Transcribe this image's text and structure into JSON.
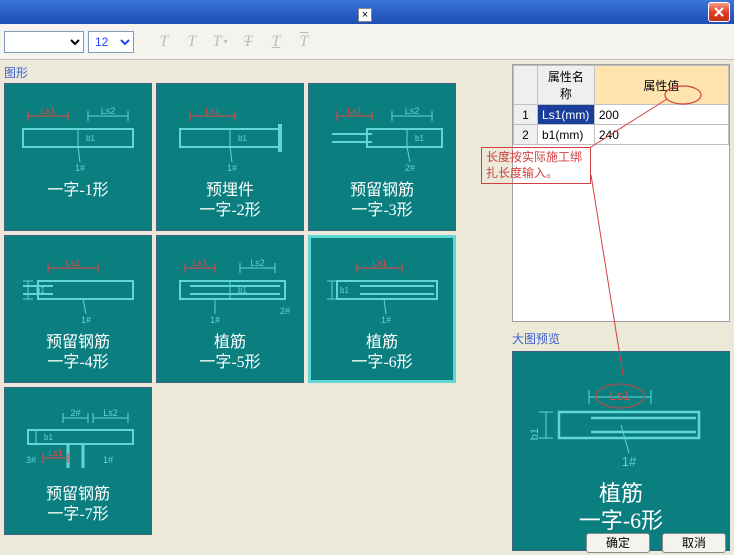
{
  "toolbar": {
    "font_value": "",
    "size_value": "12",
    "btns": [
      "T",
      "T",
      "T",
      "T",
      "T",
      "T"
    ]
  },
  "left": {
    "group_label": "图形",
    "shapes": [
      {
        "title": "一字-1形",
        "labels": {
          "ls1": "Ls1",
          "ls2": "Ls2",
          "b1": "b1",
          "num": "1#"
        },
        "type": "A"
      },
      {
        "title": "预埋件\n一字-2形",
        "labels": {
          "ls1": "Ls1",
          "b1": "b1",
          "num": "1#"
        },
        "type": "B"
      },
      {
        "title": "预留钢筋\n一字-3形",
        "labels": {
          "ls1": "Ls1",
          "ls2": "Ls2",
          "b1": "b1",
          "num": "2#"
        },
        "type": "C"
      },
      {
        "title": "预留钢筋\n一字-4形",
        "labels": {
          "ls1": "Ls1",
          "b1": "b1",
          "num": "1#"
        },
        "type": "D"
      },
      {
        "title": "植筋\n一字-5形",
        "labels": {
          "ls1": "Ls1",
          "ls2": "Ls2",
          "b1": "b1",
          "num": "1#",
          "num2": "2#"
        },
        "type": "E"
      },
      {
        "title": "植筋\n一字-6形",
        "labels": {
          "ls1": "Ls1",
          "b1": "b1",
          "num": "1#"
        },
        "type": "F",
        "selected": true
      },
      {
        "title": "预留钢筋\n一字-7形",
        "labels": {
          "ls1": "Ls1",
          "ls2": "Ls2",
          "b1": "b1",
          "n1": "1#",
          "n2": "2#",
          "n3": "3#"
        },
        "type": "G"
      }
    ]
  },
  "right": {
    "table": {
      "col_name": "属性名称",
      "col_value": "属性值",
      "rows": [
        {
          "n": "1",
          "name": "Ls1(mm)",
          "value": "200",
          "selected": true
        },
        {
          "n": "2",
          "name": "b1(mm)",
          "value": "240"
        }
      ]
    },
    "annotation": "长度按实际施工绑扎长度输入。",
    "preview_label": "大图预览",
    "preview": {
      "title": "植筋\n一字-6形",
      "labels": {
        "ls1": "Ls1",
        "b1": "b1",
        "num": "1#"
      }
    }
  },
  "footer": {
    "ok": "确定",
    "cancel": "取消"
  }
}
